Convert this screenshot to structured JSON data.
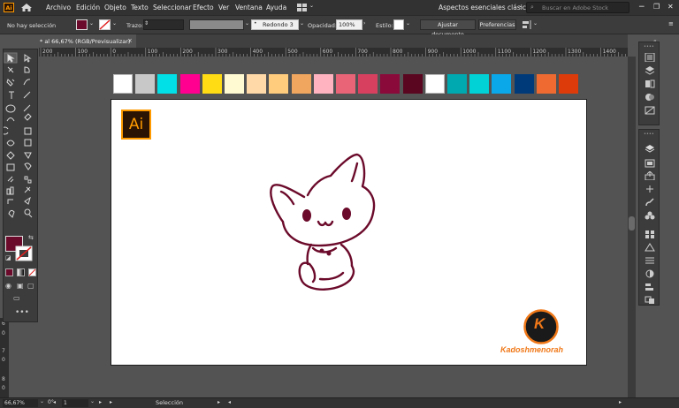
{
  "menu": {
    "app_logo": "Ai",
    "items": [
      "Archivo",
      "Edición",
      "Objeto",
      "Texto",
      "Seleccionar",
      "Efecto",
      "Ver",
      "Ventana",
      "Ayuda"
    ],
    "workspace": "Aspectos esenciales clásicos",
    "stock_search_placeholder": "Buscar en Adobe Stock"
  },
  "control_bar": {
    "selection_status": "No hay selección",
    "stroke_label": "Trazo:",
    "brush": "Redondo 3 ...",
    "opacity_label": "Opacidad:",
    "opacity_value": "100%",
    "style_label": "Estilo:",
    "adjust_document_button": "Ajustar documento",
    "preferences_button": "Preferencias",
    "fill_color": "#6b0a2a"
  },
  "document_tab": {
    "title": "* al 66,67% (RGB/Previsualizar)",
    "close": "×"
  },
  "ruler_ticks": [
    "200",
    "100",
    "0",
    "100",
    "200",
    "300",
    "400",
    "500",
    "600",
    "700",
    "800",
    "900",
    "1000",
    "1100",
    "1200",
    "1300",
    "1400"
  ],
  "swatches": [
    "#ffffff",
    "#c8c8c8",
    "#00e0e6",
    "#ff0090",
    "#ffdc14",
    "#fffad2",
    "#ffd9a8",
    "#ffcb7d",
    "#f0a65e",
    "#ffb3c1",
    "#ea6478",
    "#d84060",
    "#8a0a3a",
    "#5a0620",
    "#ffffff",
    "#00a8b0",
    "#00d2d6",
    "#0aa8e8",
    "#003a78",
    "#ee6a30",
    "#dd3c0a"
  ],
  "artboard": {
    "ai_logo": "Ai",
    "brand_initial": "K",
    "brand_name": "Kadoshmenorah",
    "line_color": "#6b0a2a"
  },
  "status_bar": {
    "zoom": "66,67%",
    "rotation": "0°",
    "artboard_number": "1",
    "tool": "Selección"
  }
}
